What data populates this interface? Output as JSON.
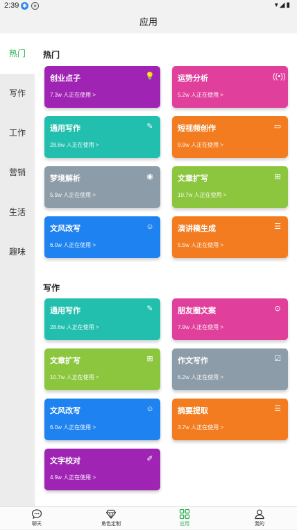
{
  "status": {
    "time": "2:39"
  },
  "header": {
    "title": "应用"
  },
  "sidebar": {
    "items": [
      {
        "label": "热门",
        "active": true
      },
      {
        "label": "写作"
      },
      {
        "label": "工作"
      },
      {
        "label": "营销"
      },
      {
        "label": "生活"
      },
      {
        "label": "趣味"
      }
    ]
  },
  "sections": {
    "hot": {
      "title": "热门",
      "cards": [
        {
          "title": "创业点子",
          "sub": "7.3w 人正在使用 >",
          "color": "#a024b4",
          "icon": "lightbulb-icon"
        },
        {
          "title": "运势分析",
          "sub": "5.2w 人正在使用 >",
          "color": "#e0409c",
          "icon": "signal-icon"
        },
        {
          "title": "通用写作",
          "sub": "28.6w 人正在使用 >",
          "color": "#22bfae",
          "icon": "pencil-icon"
        },
        {
          "title": "短视频创作",
          "sub": "9.9w 人正在使用 >",
          "color": "#f27c1f",
          "icon": "video-icon"
        },
        {
          "title": "梦境解析",
          "sub": "5.9w 人正在使用 >",
          "color": "#8c9ca8",
          "icon": "eye-icon"
        },
        {
          "title": "文章扩写",
          "sub": "10.7w 人正在使用 >",
          "color": "#8cc63e",
          "icon": "expand-icon"
        },
        {
          "title": "文风改写",
          "sub": "6.0w 人正在使用 >",
          "color": "#1e82f0",
          "icon": "chat-icon"
        },
        {
          "title": "演讲稿生成",
          "sub": "5.5w 人正在使用 >",
          "color": "#f27c1f",
          "icon": "document-icon"
        }
      ]
    },
    "writing": {
      "title": "写作",
      "cards": [
        {
          "title": "通用写作",
          "sub": "28.6w 人正在使用 >",
          "color": "#22bfae",
          "icon": "pencil-icon"
        },
        {
          "title": "朋友圈文案",
          "sub": "7.9w 人正在使用 >",
          "color": "#e0409c",
          "icon": "compass-icon"
        },
        {
          "title": "文章扩写",
          "sub": "10.7w 人正在使用 >",
          "color": "#8cc63e",
          "icon": "expand-icon"
        },
        {
          "title": "作文写作",
          "sub": "6.2w 人正在使用 >",
          "color": "#8c9ca8",
          "icon": "edit-icon"
        },
        {
          "title": "文风改写",
          "sub": "6.0w 人正在使用 >",
          "color": "#1e82f0",
          "icon": "chat-icon"
        },
        {
          "title": "摘要提取",
          "sub": "3.7w 人正在使用 >",
          "color": "#f27c1f",
          "icon": "list-icon"
        },
        {
          "title": "文字校对",
          "sub": "4.9w 人正在使用 >",
          "color": "#a024b4",
          "icon": "pen-icon"
        }
      ]
    }
  },
  "bottom_nav": [
    {
      "label": "聊天",
      "icon": "chat-bubble-icon"
    },
    {
      "label": "角色定制",
      "icon": "diamond-icon"
    },
    {
      "label": "应用",
      "icon": "apps-grid-icon",
      "active": true
    },
    {
      "label": "我的",
      "icon": "user-icon"
    }
  ],
  "colors": {
    "accent": "#2bb24c"
  }
}
